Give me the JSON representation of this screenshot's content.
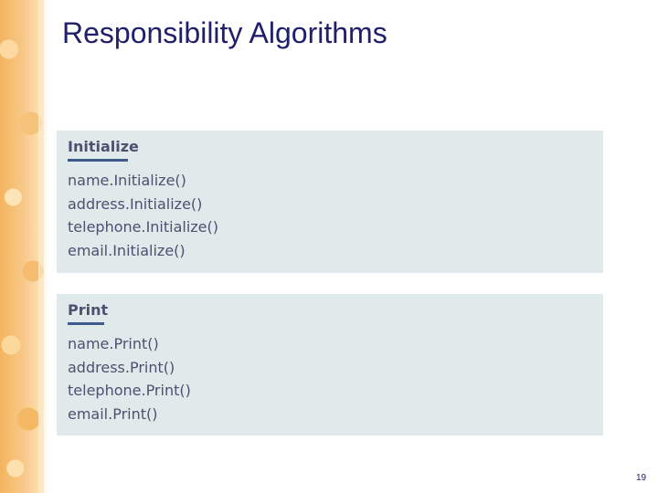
{
  "slide": {
    "title": "Responsibility Algorithms",
    "page_number": "19"
  },
  "panels": {
    "initialize": {
      "heading": "Initialize",
      "lines": [
        "name.Initialize()",
        "address.Initialize()",
        "telephone.Initialize()",
        "email.Initialize()"
      ]
    },
    "print": {
      "heading": "Print",
      "lines": [
        "name.Print()",
        "address.Print()",
        "telephone.Print()",
        "email.Print()"
      ]
    }
  },
  "colors": {
    "title": "#1f1f6b",
    "panel_background": "#e1eaea",
    "heading_rule": "#3d5a8a",
    "side_band": "#f4b45e"
  }
}
